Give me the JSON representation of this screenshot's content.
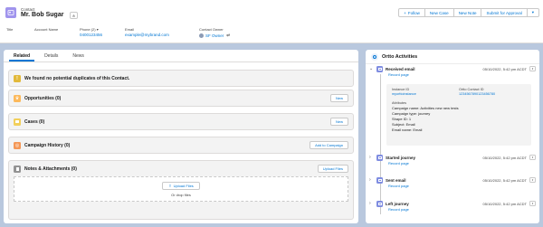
{
  "header": {
    "object_type": "Contact",
    "record_name": "Mr. Bob Sugar",
    "buttons": [
      "Follow",
      "New Case",
      "New Note",
      "Submit for Approval"
    ],
    "follow_prefix": "+",
    "highlights": {
      "title_label": "Title",
      "account_label": "Account Name",
      "phone_label": "Phone (2)",
      "phone_value": "0400123456",
      "email_label": "Email",
      "email_value": "example@mybrand.com",
      "owner_label": "Contact Owner",
      "owner_value": "SF Owner"
    }
  },
  "tabs": [
    "Related",
    "Details",
    "News"
  ],
  "related": {
    "duplicates": "We found no potential duplicates of this Contact.",
    "opportunities": {
      "title": "Opportunities (0)",
      "button": "New"
    },
    "cases": {
      "title": "Cases (0)",
      "button": "New"
    },
    "campaign_history": {
      "title": "Campaign History (0)",
      "button": "Add to Campaign"
    },
    "notes": {
      "title": "Notes & Attachments (0)",
      "button": "Upload Files",
      "upload_button": "Upload Files",
      "drop_text": "Or drop files"
    }
  },
  "ortto": {
    "title": "Ortto Activities",
    "activities": [
      {
        "title": "Received email",
        "time": "05/10/2022, 5:42 pm ACDT",
        "link": "Record page",
        "expanded": true
      },
      {
        "title": "Started journey",
        "time": "05/10/2022, 5:42 pm ACDT",
        "link": "Record page",
        "expanded": false
      },
      {
        "title": "Sent email",
        "time": "05/10/2022, 5:42 pm ACDT",
        "link": "Record page",
        "expanded": false
      },
      {
        "title": "Left journey",
        "time": "05/10/2022, 5:42 pm ACDT",
        "link": "Record page",
        "expanded": false
      }
    ],
    "detail": {
      "instance_label": "Instance ID",
      "instance_value": "myorttoinstance",
      "contact_label": "Ortto Contact ID",
      "contact_value": "1234567890123456780",
      "attributes_label": "Attributes",
      "attributes": [
        "Campaign name: Activities new new tests",
        "Campaign type: journey",
        "Shape ID: 1",
        "Subject: Email",
        "Email name: Email"
      ]
    }
  },
  "colors": {
    "brand": "#0176d3",
    "contact_icon": "#a094ed",
    "background": "#b9c8de"
  }
}
